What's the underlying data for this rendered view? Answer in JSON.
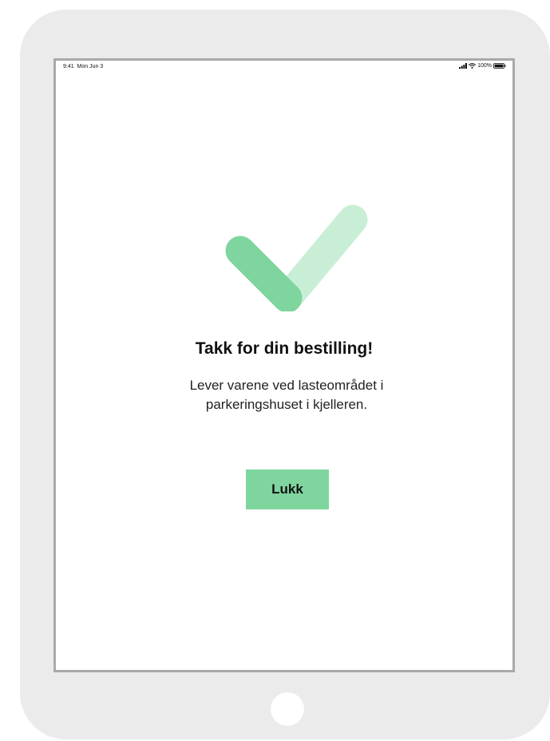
{
  "status_bar": {
    "time": "9:41",
    "date": "Mon Jun 3",
    "battery": "100%"
  },
  "confirmation": {
    "title": "Takk for din bestilling!",
    "message": "Lever varene ved lasteområdet i parkeringshuset i kjelleren.",
    "close_label": "Lukk"
  },
  "icons": {
    "confirmation": "checkmark-icon",
    "signal": "signal-icon",
    "wifi": "wifi-icon",
    "battery": "battery-icon"
  },
  "colors": {
    "accent": "#7fd59e",
    "accent_light": "#c9eed6",
    "device_frame": "#ebebeb",
    "screen_border": "#a9a9a9"
  }
}
